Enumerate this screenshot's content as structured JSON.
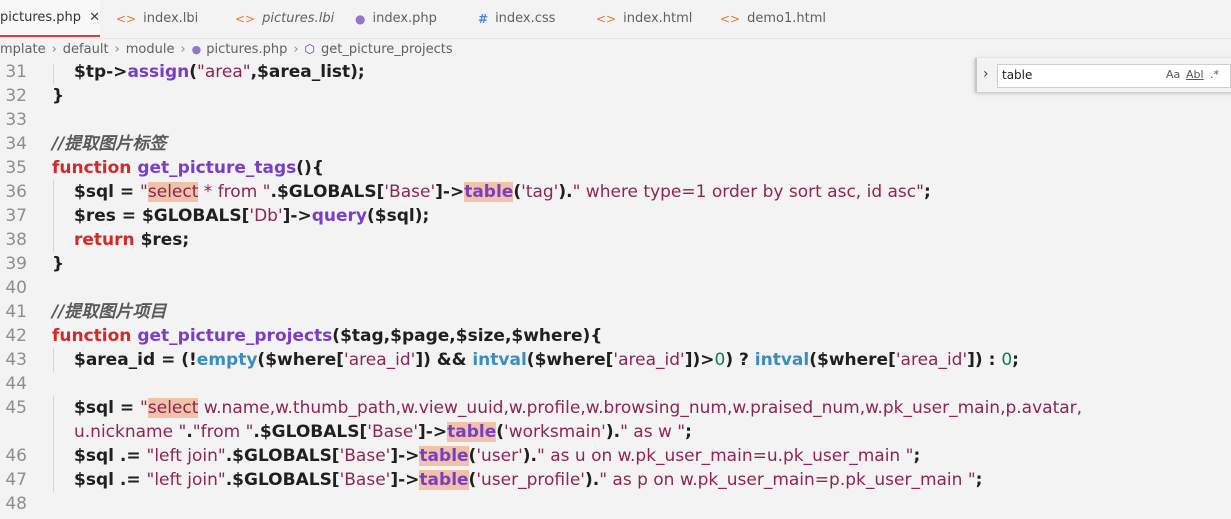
{
  "tabs": [
    {
      "label": "pictures.php",
      "icon": "php-elephant-icon",
      "active": true,
      "italic": false
    },
    {
      "label": "index.lbi",
      "icon": "html-brackets-icon",
      "active": false,
      "italic": false
    },
    {
      "label": "pictures.lbi",
      "icon": "html-brackets-icon",
      "active": false,
      "italic": true
    },
    {
      "label": "index.php",
      "icon": "php-elephant-icon",
      "active": false,
      "italic": false
    },
    {
      "label": "index.css",
      "icon": "css-hash-icon",
      "active": false,
      "italic": false
    },
    {
      "label": "index.html",
      "icon": "html-brackets-icon",
      "active": false,
      "italic": false
    },
    {
      "label": "demo1.html",
      "icon": "html-brackets-icon",
      "active": false,
      "italic": false
    }
  ],
  "breadcrumb": [
    "mplate",
    "default",
    "module",
    "pictures.php",
    "get_picture_projects"
  ],
  "find_widget": {
    "value": "table",
    "options": [
      "Aa",
      "Abl",
      ".*"
    ]
  },
  "lines": [
    {
      "n": "31",
      "indent": true,
      "tokens": [
        [
          "var",
          "$tp"
        ],
        [
          "plain",
          "->"
        ],
        [
          "fn",
          "assign"
        ],
        [
          "plain",
          "("
        ],
        [
          "str",
          "\"area\""
        ],
        [
          "plain",
          ",$area_list);"
        ]
      ]
    },
    {
      "n": "32",
      "indent": false,
      "tokens": [
        [
          "plain",
          "}"
        ]
      ]
    },
    {
      "n": "33",
      "indent": false,
      "tokens": []
    },
    {
      "n": "34",
      "indent": false,
      "tokens": [
        [
          "cmt",
          "//提取图片标签"
        ]
      ]
    },
    {
      "n": "35",
      "indent": false,
      "tokens": [
        [
          "kw",
          "function "
        ],
        [
          "fn",
          "get_picture_tags"
        ],
        [
          "plain",
          "(){"
        ]
      ]
    },
    {
      "n": "36",
      "indent": true,
      "tokens": [
        [
          "var",
          "$sql"
        ],
        [
          "plain",
          " = "
        ],
        [
          "str",
          "\""
        ],
        [
          "strhl",
          "select"
        ],
        [
          "str",
          " * from \""
        ],
        [
          "plain",
          ".$GLOBALS["
        ],
        [
          "str",
          "'Base'"
        ],
        [
          "plain",
          "]->"
        ],
        [
          "fnhl",
          "table"
        ],
        [
          "plain",
          "("
        ],
        [
          "str",
          "'tag'"
        ],
        [
          "plain",
          ")."
        ],
        [
          "str",
          "\" where type=1 order by sort asc, id asc\""
        ],
        [
          "plain",
          ";"
        ]
      ]
    },
    {
      "n": "37",
      "indent": true,
      "tokens": [
        [
          "var",
          "$res"
        ],
        [
          "plain",
          " = $GLOBALS["
        ],
        [
          "str",
          "'Db'"
        ],
        [
          "plain",
          "]->"
        ],
        [
          "fn",
          "query"
        ],
        [
          "plain",
          "($sql);"
        ]
      ]
    },
    {
      "n": "38",
      "indent": true,
      "tokens": [
        [
          "kw",
          "return "
        ],
        [
          "plain",
          "$res;"
        ]
      ]
    },
    {
      "n": "39",
      "indent": false,
      "tokens": [
        [
          "plain",
          "}"
        ]
      ]
    },
    {
      "n": "40",
      "indent": false,
      "tokens": []
    },
    {
      "n": "41",
      "indent": false,
      "tokens": [
        [
          "cmt",
          "//提取图片项目"
        ]
      ]
    },
    {
      "n": "42",
      "indent": false,
      "tokens": [
        [
          "kw",
          "function "
        ],
        [
          "fn",
          "get_picture_projects"
        ],
        [
          "plain",
          "($tag,$page,$size,$where){"
        ]
      ]
    },
    {
      "n": "43",
      "indent": true,
      "tokens": [
        [
          "var",
          "$area_id"
        ],
        [
          "plain",
          " = (!"
        ],
        [
          "bi",
          "empty"
        ],
        [
          "plain",
          "($where["
        ],
        [
          "str",
          "'area_id'"
        ],
        [
          "plain",
          "]) && "
        ],
        [
          "bi",
          "intval"
        ],
        [
          "plain",
          "($where["
        ],
        [
          "str",
          "'area_id'"
        ],
        [
          "plain",
          "])>"
        ],
        [
          "num",
          "0"
        ],
        [
          "plain",
          ") ? "
        ],
        [
          "bi",
          "intval"
        ],
        [
          "plain",
          "($where["
        ],
        [
          "str",
          "'area_id'"
        ],
        [
          "plain",
          "]) : "
        ],
        [
          "num",
          "0"
        ],
        [
          "plain",
          ";"
        ]
      ]
    },
    {
      "n": "44",
      "indent": false,
      "tokens": []
    },
    {
      "n": "45",
      "indent": true,
      "tokens": [
        [
          "var",
          "$sql"
        ],
        [
          "plain",
          " = "
        ],
        [
          "str",
          "\""
        ],
        [
          "strhl",
          "select"
        ],
        [
          "str",
          " w.name,w.thumb_path,w.view_uuid,w.profile,w.browsing_num,w.praised_num,w.pk_user_main,p.avatar,"
        ]
      ]
    },
    {
      "n": "",
      "indent": true,
      "tokens": [
        [
          "str",
          "u.nickname \""
        ],
        [
          "plain",
          "."
        ],
        [
          "str",
          "\"from \""
        ],
        [
          "plain",
          ".$GLOBALS["
        ],
        [
          "str",
          "'Base'"
        ],
        [
          "plain",
          "]->"
        ],
        [
          "fnhl",
          "table"
        ],
        [
          "plain",
          "("
        ],
        [
          "str",
          "'worksmain'"
        ],
        [
          "plain",
          ")."
        ],
        [
          "str",
          "\" as w \""
        ],
        [
          "plain",
          ";"
        ]
      ]
    },
    {
      "n": "46",
      "indent": true,
      "tokens": [
        [
          "var",
          "$sql"
        ],
        [
          "plain",
          " .= "
        ],
        [
          "str",
          "\"left join\""
        ],
        [
          "plain",
          ".$GLOBALS["
        ],
        [
          "str",
          "'Base'"
        ],
        [
          "plain",
          "]->"
        ],
        [
          "fnhl",
          "table"
        ],
        [
          "plain",
          "("
        ],
        [
          "str",
          "'user'"
        ],
        [
          "plain",
          ")."
        ],
        [
          "str",
          "\" as u on w.pk_user_main=u.pk_user_main \""
        ],
        [
          "plain",
          ";"
        ]
      ]
    },
    {
      "n": "47",
      "indent": true,
      "tokens": [
        [
          "var",
          "$sql"
        ],
        [
          "plain",
          " .= "
        ],
        [
          "str",
          "\"left join\""
        ],
        [
          "plain",
          ".$GLOBALS["
        ],
        [
          "str",
          "'Base'"
        ],
        [
          "plain",
          "]->"
        ],
        [
          "fnhl",
          "table"
        ],
        [
          "plain",
          "("
        ],
        [
          "str",
          "'user_profile'"
        ],
        [
          "plain",
          ")."
        ],
        [
          "str",
          "\" as p on w.pk_user_main=p.pk_user_main \""
        ],
        [
          "plain",
          ";"
        ]
      ]
    },
    {
      "n": "48",
      "indent": false,
      "tokens": []
    }
  ]
}
